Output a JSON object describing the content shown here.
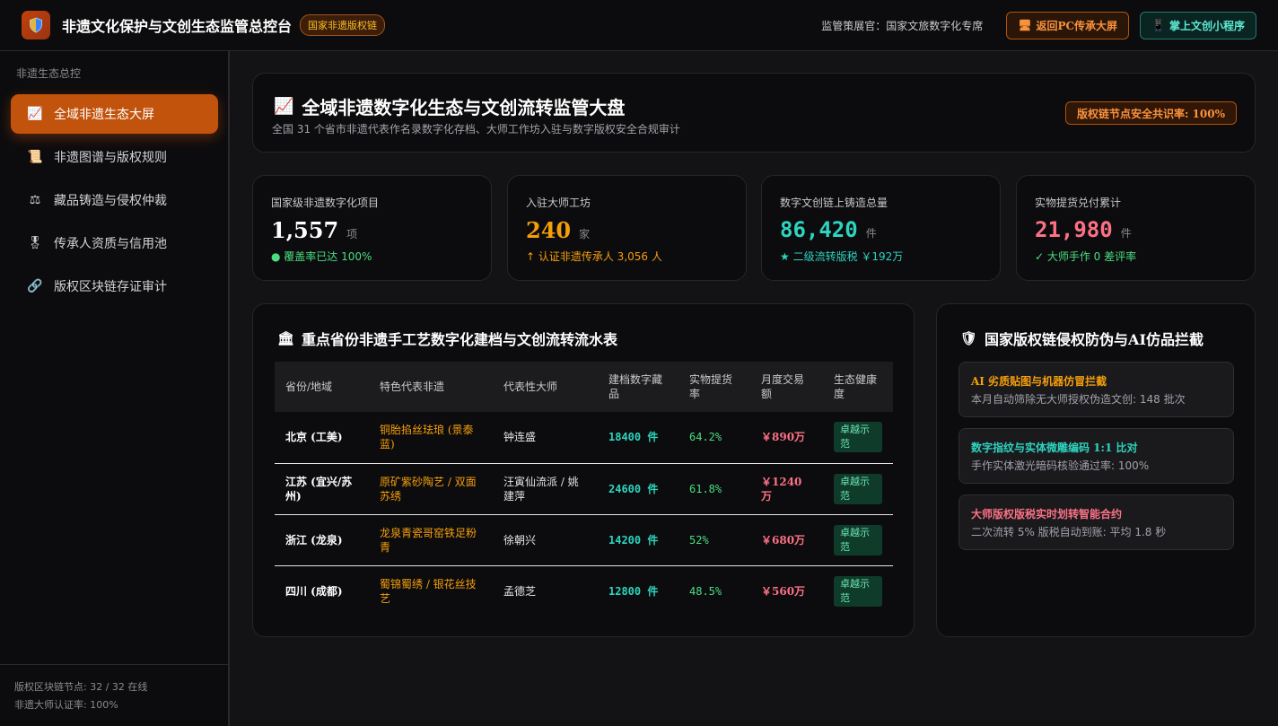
{
  "topbar": {
    "logo_icon": "shield-icon",
    "title": "非遗文化保护与文创生态监管总控台",
    "badge": "国家非遗版权链",
    "curator": "监管策展官：国家文旅数字化专席",
    "btn_pc": "返回PC传承大屏",
    "btn_pc_icon": "monitor-icon",
    "btn_mini": "掌上文创小程序",
    "btn_mini_icon": "phone-icon"
  },
  "sidebar": {
    "heading": "非遗生态总控",
    "items": [
      {
        "label": "全域非遗生态大屏",
        "icon": "chart-up-icon",
        "active": true
      },
      {
        "label": "非遗图谱与版权规则",
        "icon": "scroll-icon",
        "active": false
      },
      {
        "label": "藏品铸造与侵权仲裁",
        "icon": "scales-icon",
        "active": false
      },
      {
        "label": "传承人资质与信用池",
        "icon": "medal-icon",
        "active": false
      },
      {
        "label": "版权区块链存证审计",
        "icon": "link-icon",
        "active": false
      }
    ],
    "footer_nodes": "版权区块链节点: 32 / 32 在线",
    "footer_cert": "非遗大师认证率: 100%"
  },
  "hero": {
    "icon": "chart-up-icon",
    "title": "全域非遗数字化生态与文创流转监管大盘",
    "subtitle": "全国 31 个省市非遗代表作名录数字化存档、大师工作坊入驻与数字版权安全合规审计",
    "consensus": "版权链节点安全共识率: 100%"
  },
  "stats": [
    {
      "label": "国家级非遗数字化项目",
      "value": "1,557",
      "unit": "项",
      "note": "● 覆盖率已达 100%",
      "value_color": "#ffffff",
      "note_color": "#4ade80"
    },
    {
      "label": "入驻大师工坊",
      "value": "240",
      "unit": "家",
      "note": "↑ 认证非遗传承人 3,056 人",
      "value_color": "#f59e0b",
      "note_color": "#f59e0b"
    },
    {
      "label": "数字文创链上铸造总量",
      "value": "86,420",
      "unit": "件",
      "note": "★ 二级流转版税 ￥192万",
      "value_color": "#2dd4bf",
      "note_color": "#2dd4bf"
    },
    {
      "label": "实物提货兑付累计",
      "value": "21,980",
      "unit": "件",
      "note": "✓ 大师手作 0 差评率",
      "value_color": "#fb7185",
      "note_color": "#4ade80"
    }
  ],
  "table": {
    "icon": "museum-icon",
    "title": "重点省份非遗手工艺数字化建档与文创流转流水表",
    "headers": [
      "省份/地域",
      "特色代表非遗",
      "代表性大师",
      "建档数字藏品",
      "实物提货率",
      "月度交易额",
      "生态健康度"
    ],
    "rows": [
      {
        "province": "北京 (工美)",
        "heritage": "铜胎掐丝珐琅 (景泰蓝)",
        "master": "钟连盛",
        "items": "18400 件",
        "rate": "64.2%",
        "trade": "￥890万",
        "health": "卓越示范"
      },
      {
        "province": "江苏 (宜兴/苏州)",
        "heritage": "原矿紫砂陶艺 / 双面苏绣",
        "master": "汪寅仙流派 / 姚建萍",
        "items": "24600 件",
        "rate": "61.8%",
        "trade": "￥1240万",
        "health": "卓越示范"
      },
      {
        "province": "浙江 (龙泉)",
        "heritage": "龙泉青瓷哥窑铁足粉青",
        "master": "徐朝兴",
        "items": "14200 件",
        "rate": "52%",
        "trade": "￥680万",
        "health": "卓越示范"
      },
      {
        "province": "四川 (成都)",
        "heritage": "蜀锦蜀绣 / 银花丝技艺",
        "master": "孟德芝",
        "items": "12800 件",
        "rate": "48.5%",
        "trade": "￥560万",
        "health": "卓越示范"
      }
    ]
  },
  "intercept": {
    "icon": "shield-icon",
    "title": "国家版权链侵权防伪与AI仿品拦截",
    "cards": [
      {
        "title": "AI 劣质贴图与机器仿冒拦截",
        "desc": "本月自动筛除无大师授权伪造文创: 148 批次",
        "color": "#f59e0b"
      },
      {
        "title": "数字指纹与实体微雕编码 1:1 比对",
        "desc": "手作实体激光暗码核验通过率: 100%",
        "color": "#2dd4bf"
      },
      {
        "title": "大师版权版税实时划转智能合约",
        "desc": "二次流转 5% 版税自动到账: 平均 1.8 秒",
        "color": "#fb7185"
      }
    ]
  }
}
